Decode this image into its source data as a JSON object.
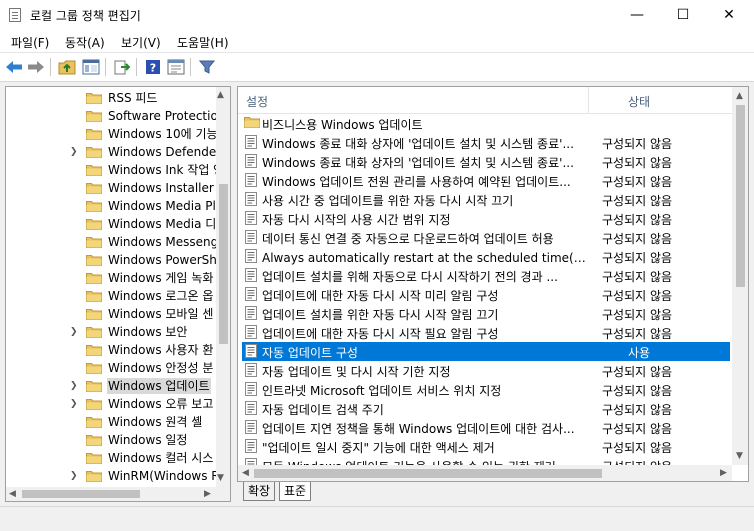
{
  "window": {
    "title": "로컬 그룹 정책 편집기",
    "min_glyph": "—",
    "max_glyph": "☐",
    "close_glyph": "✕"
  },
  "menu": [
    {
      "label": "파일(F)"
    },
    {
      "label": "동작(A)"
    },
    {
      "label": "보기(V)"
    },
    {
      "label": "도움말(H)"
    }
  ],
  "tree": {
    "items": [
      {
        "label": "RSS 피드",
        "expandable": false,
        "selected": false
      },
      {
        "label": "Software Protection",
        "expandable": false,
        "selected": false
      },
      {
        "label": "Windows 10에 기능",
        "expandable": false,
        "selected": false
      },
      {
        "label": "Windows Defender S",
        "expandable": true,
        "selected": false
      },
      {
        "label": "Windows Ink 작업 영",
        "expandable": false,
        "selected": false
      },
      {
        "label": "Windows Installer",
        "expandable": false,
        "selected": false
      },
      {
        "label": "Windows Media Play",
        "expandable": false,
        "selected": false
      },
      {
        "label": "Windows Media 디지",
        "expandable": false,
        "selected": false
      },
      {
        "label": "Windows Messenger",
        "expandable": false,
        "selected": false
      },
      {
        "label": "Windows PowerShel",
        "expandable": false,
        "selected": false
      },
      {
        "label": "Windows 게임 녹화",
        "expandable": false,
        "selected": false
      },
      {
        "label": "Windows 로그온 옵",
        "expandable": false,
        "selected": false
      },
      {
        "label": "Windows 모바일 센",
        "expandable": false,
        "selected": false
      },
      {
        "label": "Windows 보안",
        "expandable": true,
        "selected": false
      },
      {
        "label": "Windows 사용자 환",
        "expandable": false,
        "selected": false
      },
      {
        "label": "Windows 안정성 분",
        "expandable": false,
        "selected": false
      },
      {
        "label": "Windows 업데이트",
        "expandable": true,
        "selected": true
      },
      {
        "label": "Windows 오류 보고",
        "expandable": true,
        "selected": false
      },
      {
        "label": "Windows 원격 셸",
        "expandable": false,
        "selected": false
      },
      {
        "label": "Windows 일정",
        "expandable": false,
        "selected": false
      },
      {
        "label": "Windows 컬러 시스",
        "expandable": false,
        "selected": false
      },
      {
        "label": "WinRM(Windows Re",
        "expandable": true,
        "selected": false
      }
    ]
  },
  "list": {
    "col_setting": "설정",
    "col_status": "상태",
    "rows": [
      {
        "icon": "folder",
        "name": "비즈니스용 Windows 업데이트",
        "status": "",
        "selected": false
      },
      {
        "icon": "policy",
        "name": "Windows 종료 대화 상자에 '업데이트 설치 및 시스템 종료'...",
        "status": "구성되지 않음",
        "selected": false
      },
      {
        "icon": "policy",
        "name": "Windows 종료 대화 상자의 '업데이트 설치 및 시스템 종료'...",
        "status": "구성되지 않음",
        "selected": false
      },
      {
        "icon": "policy",
        "name": "Windows 업데이트 전원 관리를 사용하여 예약된 업데이트...",
        "status": "구성되지 않음",
        "selected": false
      },
      {
        "icon": "policy",
        "name": "사용 시간 중 업데이트를 위한 자동 다시 시작 끄기",
        "status": "구성되지 않음",
        "selected": false
      },
      {
        "icon": "policy",
        "name": "자동 다시 시작의 사용 시간 범위 지정",
        "status": "구성되지 않음",
        "selected": false
      },
      {
        "icon": "policy",
        "name": "데이터 통신 연결 중 자동으로 다운로드하여 업데이트 허용",
        "status": "구성되지 않음",
        "selected": false
      },
      {
        "icon": "policy",
        "name": "Always automatically restart at the scheduled time(항상 예...",
        "status": "구성되지 않음",
        "selected": false
      },
      {
        "icon": "policy",
        "name": "업데이트 설치를 위해 자동으로 다시 시작하기 전의 경과 ...",
        "status": "구성되지 않음",
        "selected": false
      },
      {
        "icon": "policy",
        "name": "업데이트에 대한 자동 다시 시작 미리 알림 구성",
        "status": "구성되지 않음",
        "selected": false
      },
      {
        "icon": "policy",
        "name": "업데이트 설치를 위한 자동 다시 시작 알림 끄기",
        "status": "구성되지 않음",
        "selected": false
      },
      {
        "icon": "policy",
        "name": "업데이트에 대한 자동 다시 시작 필요 알림 구성",
        "status": "구성되지 않음",
        "selected": false
      },
      {
        "icon": "policy",
        "name": "자동 업데이트 구성",
        "status": "사용",
        "selected": true
      },
      {
        "icon": "policy",
        "name": "자동 업데이트 및 다시 시작 기한 지정",
        "status": "구성되지 않음",
        "selected": false
      },
      {
        "icon": "policy",
        "name": "인트라넷 Microsoft 업데이트 서비스 위치 지정",
        "status": "구성되지 않음",
        "selected": false
      },
      {
        "icon": "policy",
        "name": "자동 업데이트 검색 주기",
        "status": "구성되지 않음",
        "selected": false
      },
      {
        "icon": "policy",
        "name": "업데이트 지연 정책을 통해 Windows 업데이트에 대한 검사...",
        "status": "구성되지 않음",
        "selected": false
      },
      {
        "icon": "policy",
        "name": "\"업데이트 일시 중지\" 기능에 대한 액세스 제거",
        "status": "구성되지 않음",
        "selected": false
      },
      {
        "icon": "policy",
        "name": "모든 Windows 업데이트 기능을 사용할 수 있는 권한 제거",
        "status": "구성되지 않음",
        "selected": false
      }
    ]
  },
  "tabs": [
    {
      "label": "확장",
      "active": false
    },
    {
      "label": "표준",
      "active": true
    }
  ],
  "colors": {
    "accent": "#0078d7",
    "folder": "#e8c25e",
    "header_text": "#4c607a"
  }
}
